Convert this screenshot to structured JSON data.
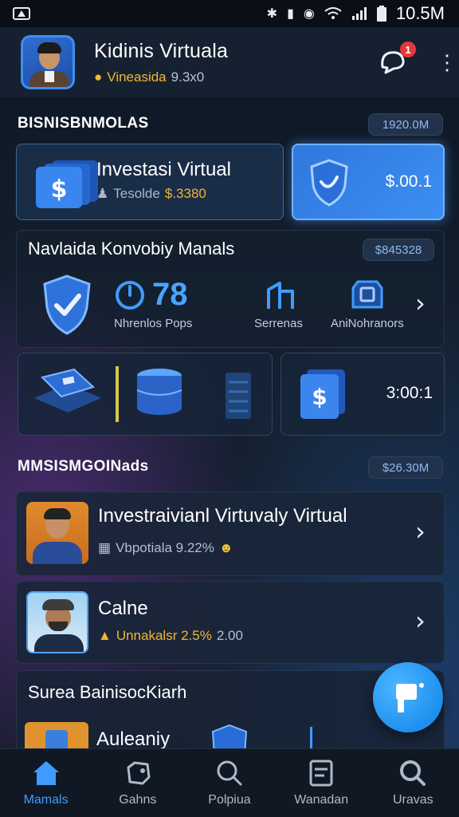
{
  "status_bar": {
    "time": "10.5M",
    "icons": [
      "warning-icon",
      "vibrate-icon",
      "nfc-icon",
      "alarm-icon",
      "wifi-icon",
      "signal-icon",
      "battery-icon"
    ]
  },
  "header": {
    "title": "Kidinis Virtuala",
    "subtitle_label": "Vineasida",
    "subtitle_value": "9.3x0",
    "notification_count": "1"
  },
  "section1": {
    "title": "BISNISBNMOLAS",
    "pill": "1920.0M",
    "invest_card": {
      "title": "Investasi Virtual",
      "sub_label": "Tesolde",
      "sub_value": "$.3380"
    },
    "shield_card_value": "$.00.1"
  },
  "section2": {
    "title": "Navlaida Konvobiy Manals",
    "pill": "$845328",
    "stat_value": "78",
    "stat_label": "Nhrenlos Pops",
    "feature_1": "Serrenas",
    "feature_2": "AniNohranors",
    "money_card_value": "3:00:1"
  },
  "section3": {
    "title": "MMSISMGOINads",
    "pill": "$26.30M",
    "items": [
      {
        "title": "Investraivianl Virtuvaly Virtual",
        "sub": "Vbpotiala 9.22%"
      },
      {
        "title": "Calne",
        "sub": "Unnakalsr 2.5%",
        "extra": "2.00"
      }
    ]
  },
  "section4": {
    "title": "Surea BainisocKiarh",
    "item_title": "Auleaniy"
  },
  "bottom_nav": [
    {
      "label": "Mamals",
      "icon": "home-icon",
      "active": true
    },
    {
      "label": "Gahns",
      "icon": "gamepad-icon",
      "active": false
    },
    {
      "label": "Polpiua",
      "icon": "search-icon",
      "active": false
    },
    {
      "label": "Wanadan",
      "icon": "document-icon",
      "active": false
    },
    {
      "label": "Uravas",
      "icon": "magnifier-icon",
      "active": false
    }
  ],
  "colors": {
    "accent": "#3f9cff",
    "gold": "#f2b533",
    "background": "#14202f"
  }
}
